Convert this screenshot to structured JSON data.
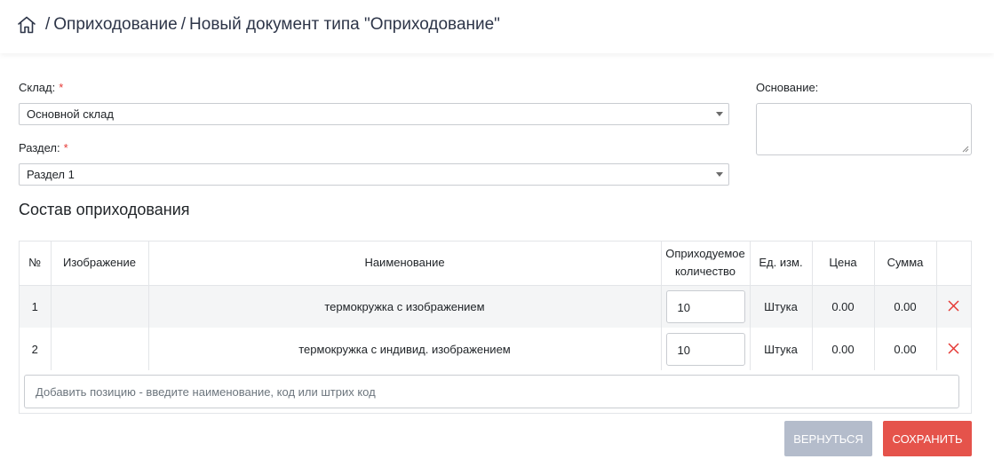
{
  "breadcrumb": {
    "separator": "/",
    "items": [
      "Оприходование",
      "Новый документ типа \"Оприходование\""
    ]
  },
  "form": {
    "warehouse": {
      "label": "Склад:",
      "required_mark": "*",
      "value": "Основной склад"
    },
    "section": {
      "label": "Раздел:",
      "required_mark": "*",
      "value": "Раздел 1"
    },
    "basis": {
      "label": "Основание:",
      "value": ""
    }
  },
  "composition": {
    "title": "Состав оприходования",
    "columns": [
      "№",
      "Изображение",
      "Наименование",
      "Оприходуемое количество",
      "Ед. изм.",
      "Цена",
      "Сумма"
    ],
    "rows": [
      {
        "num": "1",
        "image": "",
        "name": "термокружка с изображением",
        "qty": "10",
        "unit": "Штука",
        "price": "0.00",
        "sum": "0.00"
      },
      {
        "num": "2",
        "image": "",
        "name": "термокружка с индивид. изображением",
        "qty": "10",
        "unit": "Штука",
        "price": "0.00",
        "sum": "0.00"
      }
    ],
    "add_placeholder": "Добавить позицию - введите наименование, код или штрих код"
  },
  "actions": {
    "back": "ВЕРНУТЬСЯ",
    "save": "СОХРАНИТЬ"
  },
  "icons": {
    "home": "home-icon",
    "delete": "close-icon",
    "dropdown": "chevron-down-icon"
  },
  "colors": {
    "accent_red": "#e5534b",
    "back_button": "#b4bccb",
    "required": "#e53935"
  }
}
